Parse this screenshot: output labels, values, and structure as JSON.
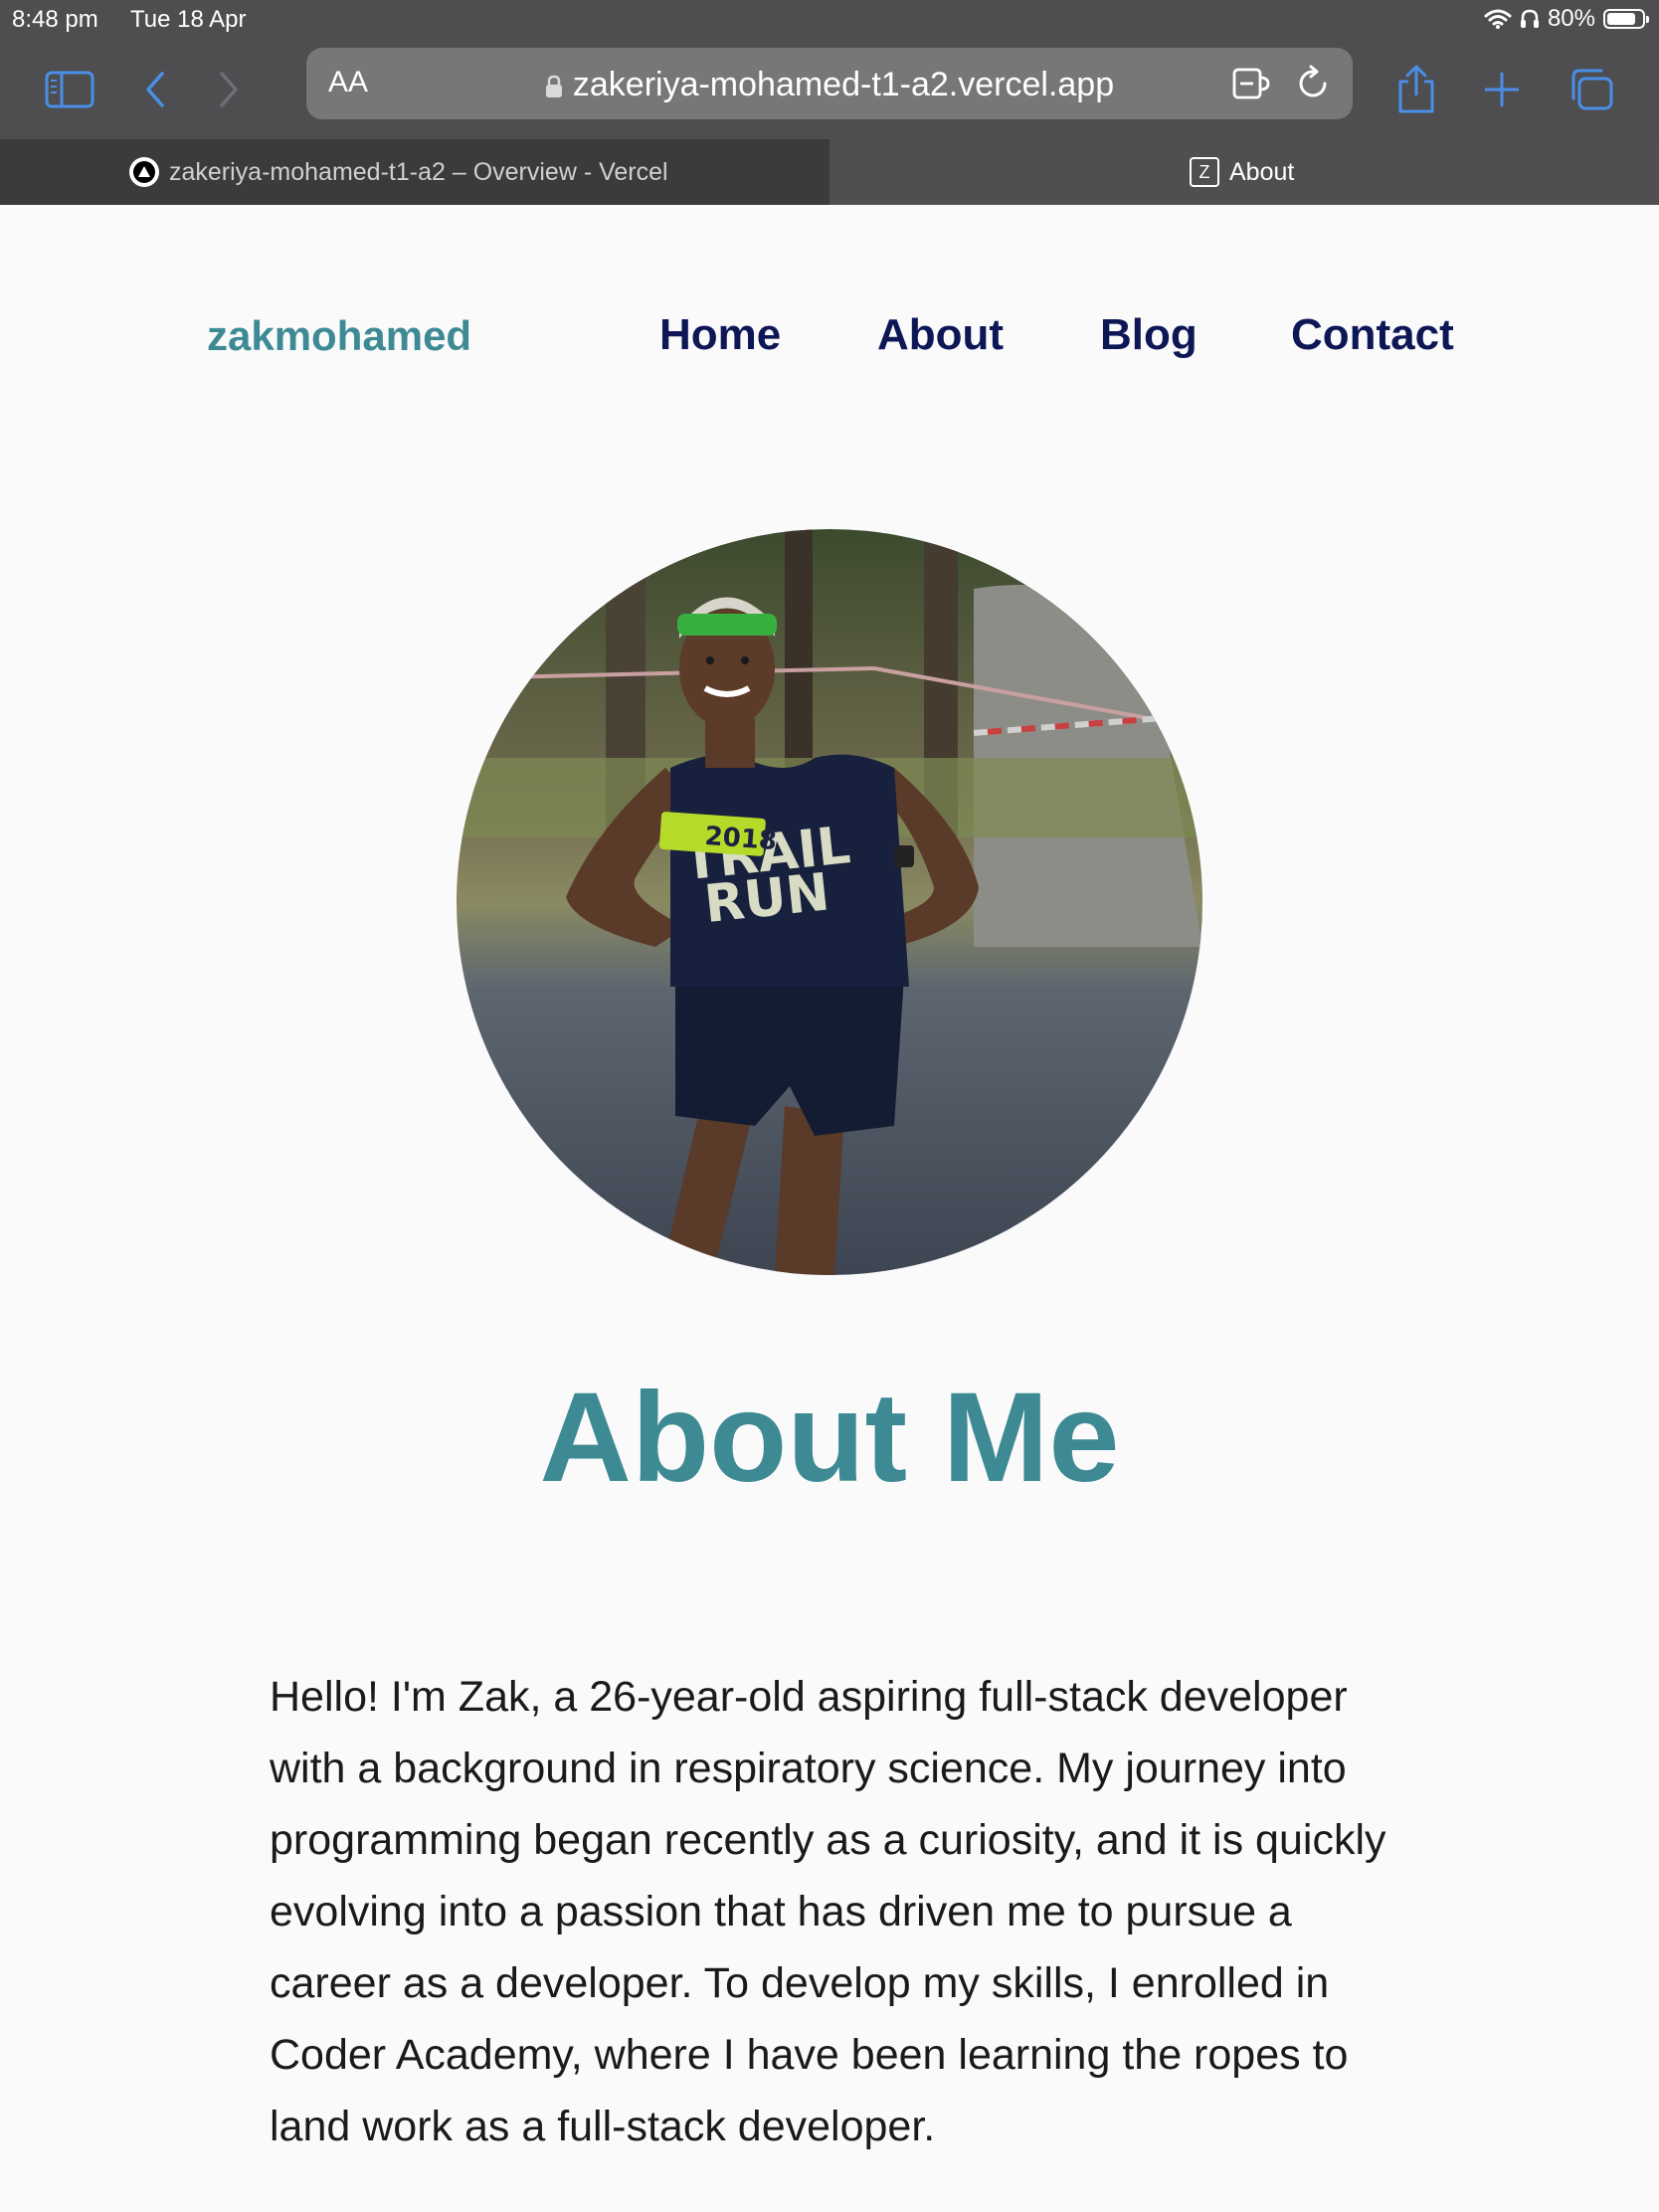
{
  "status_bar": {
    "time": "8:48 pm",
    "date": "Tue 18 Apr",
    "battery": "80%"
  },
  "browser": {
    "text_size_label": "AA",
    "url": "zakeriya-mohamed-t1-a2.vercel.app",
    "tabs": [
      {
        "label": "zakeriya-mohamed-t1-a2 – Overview - Vercel",
        "favicon": "vercel-icon"
      },
      {
        "label": "About",
        "favicon": "z-icon"
      }
    ]
  },
  "site": {
    "brand": "zakmohamed",
    "nav": [
      "Home",
      "About",
      "Blog",
      "Contact"
    ],
    "headline": "About Me",
    "bio": "Hello! I'm Zak, a 26-year-old aspiring full-stack developer with a background in respiratory science. My journey into programming began recently as a curiosity, and it is quickly evolving into a passion that has driven me to pursue a career as a developer. To develop my skills, I enrolled in Coder Academy, where I have been learning the ropes to land work as a full-stack developer.",
    "bib_number": "2018"
  },
  "colors": {
    "accent": "#3e8a94",
    "nav_text": "#0e1756",
    "browser_chrome": "#4e4e50",
    "ios_blue": "#4a8fe7"
  }
}
